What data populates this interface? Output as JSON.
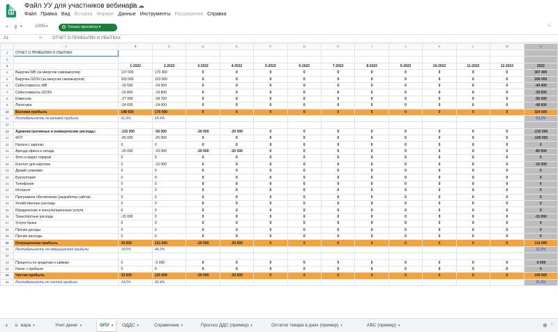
{
  "title_bar": {
    "title": "Файл УУ для участников вебинара",
    "star_icon": "☆",
    "drive_icon": "⛁",
    "cloud_icon": "☁"
  },
  "menu": [
    "Файл",
    "Правка",
    "Вид",
    "Вставка",
    "Формат",
    "Данные",
    "Инструменты",
    "Расширения",
    "Справка"
  ],
  "menu_disabled": [
    3,
    4,
    7
  ],
  "toolbar": {
    "zoom": "100%",
    "view_mode": "Только просмотр"
  },
  "formula_bar": {
    "cell_ref": "A1",
    "fx": "fx",
    "value": "ОТЧЕТ О ПРИБЫЛЯХ И УБЫТКАХ"
  },
  "columns": [
    "A",
    "B",
    "C",
    "D",
    "E",
    "F",
    "G",
    "H",
    "I",
    "J",
    "K",
    "L",
    "M",
    "N"
  ],
  "rows": [
    {
      "n": "1",
      "type": "title",
      "label": "ОТЧЕТ О ПРИБЫЛЯХ И УБЫТКАХ",
      "cells": [
        "",
        "",
        "",
        "",
        "",
        "",
        "",
        "",
        "",
        "",
        "",
        "",
        ""
      ]
    },
    {
      "n": "2",
      "type": "blank",
      "label": "",
      "cells": [
        "",
        "",
        "",
        "",
        "",
        "",
        "",
        "",
        "",
        "",
        "",
        "",
        ""
      ]
    },
    {
      "n": "3",
      "type": "hdr",
      "label": "",
      "cells": [
        "1-2022",
        "2-2022",
        "3-2022",
        "4-2022",
        "5-2022",
        "6-2022",
        "7-2022",
        "8-2022",
        "9-2022",
        "10-2022",
        "11-2022",
        "12-2022",
        "2022"
      ]
    },
    {
      "n": "4",
      "type": "num",
      "label": "Выручка WB (за минусом самовыкупов)",
      "cells": [
        "137 000",
        "170 400",
        "0",
        "0",
        "0",
        "0",
        "0",
        "0",
        "0",
        "0",
        "0",
        "0",
        "307 400"
      ]
    },
    {
      "n": "5",
      "type": "num",
      "label": "Выручка OZON (за минусом самовыкупов)",
      "cells": [
        "103 000",
        "103 000",
        "0",
        "0",
        "0",
        "0",
        "0",
        "0",
        "0",
        "0",
        "0",
        "0",
        "206 000"
      ]
    },
    {
      "n": "6",
      "type": "num",
      "label": "Себестоимость WB",
      "cells": [
        "-19 500",
        "-24 900",
        "0",
        "0",
        "0",
        "0",
        "0",
        "0",
        "0",
        "0",
        "0",
        "0",
        "-44 400"
      ]
    },
    {
      "n": "7",
      "type": "num",
      "label": "Себестоимость OZON",
      "cells": [
        "-19 800",
        "-19 800",
        "0",
        "0",
        "0",
        "0",
        "0",
        "0",
        "0",
        "0",
        "0",
        "0",
        "-39 600"
      ]
    },
    {
      "n": "8",
      "type": "num",
      "label": "Комиссии",
      "cells": [
        "-27 300",
        "-28 700",
        "0",
        "0",
        "0",
        "0",
        "0",
        "0",
        "0",
        "0",
        "0",
        "0",
        "-56 000"
      ]
    },
    {
      "n": "9",
      "type": "num",
      "label": "Логистика",
      "cells": [
        "-24 600",
        "-24 000",
        "0",
        "0",
        "0",
        "0",
        "0",
        "0",
        "0",
        "0",
        "0",
        "0",
        "-48 600"
      ]
    },
    {
      "n": "10",
      "type": "or",
      "label": "Валовая прибыль",
      "cells": [
        "148 600",
        "176 000",
        "0",
        "0",
        "0",
        "0",
        "0",
        "0",
        "0",
        "0",
        "0",
        "0",
        "324 600"
      ]
    },
    {
      "n": "11",
      "type": "pct",
      "label": "Рентабельность по валовой прибыли",
      "cells": [
        "61,9%",
        "64,4%",
        "",
        "",
        "",
        "",
        "",
        "",
        "",
        "",
        "",
        "",
        "63,2%"
      ]
    },
    {
      "n": "12",
      "type": "blank",
      "label": "",
      "cells": [
        "",
        "",
        "",
        "",
        "",
        "",
        "",
        "",
        "",
        "",
        "",
        "",
        ""
      ]
    },
    {
      "n": "13",
      "type": "bold",
      "label": "Административные и коммерческие расходы:",
      "cells": [
        "-115 000",
        "-55 000",
        "-20 000",
        "-20 000",
        "0",
        "0",
        "0",
        "0",
        "0",
        "0",
        "0",
        "0",
        "-210 000"
      ]
    },
    {
      "n": "14",
      "type": "num",
      "label": "ФОТ",
      "cells": [
        "-80 000",
        "-25 000",
        "0",
        "0",
        "0",
        "0",
        "0",
        "0",
        "0",
        "0",
        "0",
        "0",
        "-105 000"
      ]
    },
    {
      "n": "15",
      "type": "num",
      "label": "Налоги с зарплат",
      "cells": [
        "0",
        "0",
        "0",
        "0",
        "0",
        "0",
        "0",
        "0",
        "0",
        "0",
        "0",
        "0",
        "0"
      ]
    },
    {
      "n": "16",
      "type": "num",
      "label": "Аренда офиса и склада",
      "cells": [
        "-20 000",
        "-20 000",
        "-20 000",
        "-20 000",
        "0",
        "0",
        "0",
        "0",
        "0",
        "0",
        "0",
        "0",
        "-80 000"
      ]
    },
    {
      "n": "17",
      "type": "num",
      "label": "Фото и видео товаров",
      "cells": [
        "0",
        "0",
        "0",
        "0",
        "0",
        "0",
        "0",
        "0",
        "0",
        "0",
        "0",
        "0",
        "0"
      ]
    },
    {
      "n": "18",
      "type": "num",
      "label": "Контент для карточек",
      "cells": [
        "0",
        "-10 000",
        "0",
        "0",
        "0",
        "0",
        "0",
        "0",
        "0",
        "0",
        "0",
        "0",
        "-10 000"
      ]
    },
    {
      "n": "19",
      "type": "num",
      "label": "Дизайн упаковки",
      "cells": [
        "0",
        "0",
        "0",
        "0",
        "0",
        "0",
        "0",
        "0",
        "0",
        "0",
        "0",
        "0",
        "0"
      ]
    },
    {
      "n": "20",
      "type": "num",
      "label": "Бухгалтерия",
      "cells": [
        "0",
        "0",
        "0",
        "0",
        "0",
        "0",
        "0",
        "0",
        "0",
        "0",
        "0",
        "0",
        "0"
      ]
    },
    {
      "n": "21",
      "type": "num",
      "label": "Телефония",
      "cells": [
        "0",
        "0",
        "0",
        "0",
        "0",
        "0",
        "0",
        "0",
        "0",
        "0",
        "0",
        "0",
        "0"
      ]
    },
    {
      "n": "22",
      "type": "num",
      "label": "Интернет",
      "cells": [
        "0",
        "0",
        "0",
        "0",
        "0",
        "0",
        "0",
        "0",
        "0",
        "0",
        "0",
        "0",
        "0"
      ]
    },
    {
      "n": "23",
      "type": "num",
      "label": "Програмное обеспечение (разработка сайтов)",
      "cells": [
        "0",
        "0",
        "0",
        "0",
        "0",
        "0",
        "0",
        "0",
        "0",
        "0",
        "0",
        "0",
        "0"
      ]
    },
    {
      "n": "24",
      "type": "num",
      "label": "Хозяйственные расходы",
      "cells": [
        "0",
        "0",
        "0",
        "0",
        "0",
        "0",
        "0",
        "0",
        "0",
        "0",
        "0",
        "0",
        "0"
      ]
    },
    {
      "n": "25",
      "type": "num",
      "label": "Юридические и консультационные услуги",
      "cells": [
        "0",
        "0",
        "0",
        "0",
        "0",
        "0",
        "0",
        "0",
        "0",
        "0",
        "0",
        "0",
        "0"
      ]
    },
    {
      "n": "26",
      "type": "num",
      "label": "Транспортные расходы",
      "cells": [
        "-15 000",
        "0",
        "0",
        "0",
        "0",
        "0",
        "0",
        "0",
        "0",
        "0",
        "0",
        "0",
        "-15 000"
      ]
    },
    {
      "n": "27",
      "type": "num",
      "label": "Услуги банка",
      "cells": [
        "0",
        "0",
        "0",
        "0",
        "0",
        "0",
        "0",
        "0",
        "0",
        "0",
        "0",
        "0",
        "0"
      ]
    },
    {
      "n": "28",
      "type": "num",
      "label": "Прочие доходы",
      "cells": [
        "0",
        "0",
        "0",
        "0",
        "0",
        "0",
        "0",
        "0",
        "0",
        "0",
        "0",
        "0",
        "0"
      ]
    },
    {
      "n": "29",
      "type": "num",
      "label": "Прочие расходы",
      "cells": [
        "0",
        "0",
        "0",
        "0",
        "0",
        "0",
        "0",
        "0",
        "0",
        "0",
        "0",
        "0",
        "0"
      ]
    },
    {
      "n": "30",
      "type": "or",
      "label": "Операционная прибыль",
      "cells": [
        "33 600",
        "121 000",
        "-20 000",
        "-20 000",
        "0",
        "0",
        "0",
        "0",
        "0",
        "0",
        "0",
        "0",
        "114 600"
      ]
    },
    {
      "n": "31",
      "type": "pct",
      "label": "Рентабельность по операционной прибыли",
      "cells": [
        "14,0%",
        "44,3%",
        "",
        "",
        "",
        "",
        "",
        "",
        "",
        "",
        "",
        "",
        "22,3%"
      ]
    },
    {
      "n": "32",
      "type": "blank",
      "label": "",
      "cells": [
        "",
        "",
        "",
        "",
        "",
        "",
        "",
        "",
        "",
        "",
        "",
        "",
        ""
      ]
    },
    {
      "n": "33",
      "type": "num",
      "label": "Проценты по кредитам и займам",
      "cells": [
        "0",
        "-5 000",
        "0",
        "0",
        "0",
        "0",
        "0",
        "0",
        "0",
        "0",
        "0",
        "0",
        "-5 000"
      ]
    },
    {
      "n": "34",
      "type": "num",
      "label": "Налог с прибыли",
      "cells": [
        "0",
        "0",
        "0",
        "0",
        "0",
        "0",
        "0",
        "0",
        "0",
        "0",
        "0",
        "0",
        "0"
      ]
    },
    {
      "n": "35",
      "type": "or",
      "label": "Чистая прибыль",
      "cells": [
        "33 600",
        "116 000",
        "-20 000",
        "-20 000",
        "0",
        "0",
        "0",
        "0",
        "0",
        "0",
        "0",
        "0",
        "109 600"
      ]
    },
    {
      "n": "36",
      "type": "pct",
      "label": "Рентабельность по чистой прибыли",
      "cells": [
        "14,0%",
        "42,4%",
        "",
        "",
        "",
        "",
        "",
        "",
        "",
        "",
        "",
        "",
        "21,3%"
      ]
    }
  ],
  "sheet_tabs": {
    "add": "+",
    "list": "≡",
    "items": [
      {
        "label": "вара",
        "active": false
      },
      {
        "label": "Учет денег",
        "active": false
      },
      {
        "label": "ОПУ",
        "active": true
      },
      {
        "label": "ОДДС",
        "active": false
      },
      {
        "label": "Справочник",
        "active": false
      },
      {
        "label": "Прогноз ДДС (пример)",
        "active": false
      },
      {
        "label": "Остаток товара в днях (пример)",
        "active": false
      },
      {
        "label": "ABC (пример)",
        "active": false
      }
    ]
  },
  "colors": {
    "accent_green": "#188038",
    "orange_row": "#f3a33c",
    "total_col": "#bdbdbd",
    "pct_blue": "#1a35d8"
  }
}
